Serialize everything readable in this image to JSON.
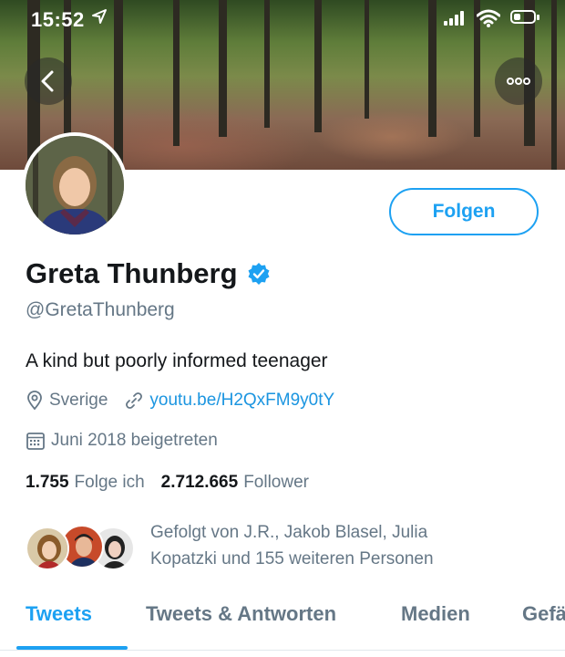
{
  "status_bar": {
    "time": "15:52",
    "battery_level": 0.35
  },
  "profile": {
    "follow_label": "Folgen",
    "name": "Greta Thunberg",
    "verified": true,
    "handle": "@GretaThunberg",
    "bio": "A kind but poorly informed teenager",
    "location": "Sverige",
    "website": "youtu.be/H2QxFM9y0tY",
    "joined": "Juni 2018 beigetreten",
    "following_count": "1.755",
    "following_label": "Folge ich",
    "followers_count": "2.712.665",
    "followers_label": "Follower",
    "followed_by_line1": "Gefolgt von J.R., Jakob Blasel, Julia",
    "followed_by_line2": "Kopatzki und 155 weiteren Personen"
  },
  "tabs": [
    {
      "label": "Tweets",
      "active": true
    },
    {
      "label": "Tweets & Antworten",
      "active": false
    },
    {
      "label": "Medien",
      "active": false
    },
    {
      "label": "Gefä",
      "active": false
    }
  ],
  "colors": {
    "accent": "#1da1f2",
    "link": "#1b95e0",
    "secondary_text": "#657786",
    "primary_text": "#14171a"
  },
  "icons": {
    "back": "chevron-left-icon",
    "more": "more-icon",
    "verified": "verified-badge-icon",
    "location": "location-pin-icon",
    "link": "link-icon",
    "calendar": "calendar-icon"
  }
}
